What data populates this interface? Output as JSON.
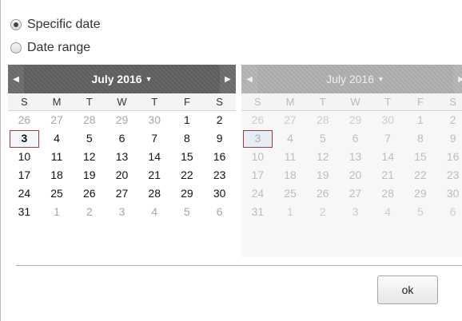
{
  "radio_options": [
    {
      "label": "Specific date",
      "checked": true
    },
    {
      "label": "Date range",
      "checked": false
    }
  ],
  "calendars": [
    {
      "month_label": "July 2016",
      "active": true,
      "prev_icon": "triangle-left-icon",
      "next_icon": "triangle-right-icon",
      "weekdays": [
        "S",
        "M",
        "T",
        "W",
        "T",
        "F",
        "S"
      ],
      "weeks": [
        [
          "26",
          "27",
          "28",
          "29",
          "30",
          "1",
          "2"
        ],
        [
          "3",
          "4",
          "5",
          "6",
          "7",
          "8",
          "9"
        ],
        [
          "10",
          "11",
          "12",
          "13",
          "14",
          "15",
          "16"
        ],
        [
          "17",
          "18",
          "19",
          "20",
          "21",
          "22",
          "23"
        ],
        [
          "24",
          "25",
          "26",
          "27",
          "28",
          "29",
          "30"
        ],
        [
          "31",
          "1",
          "2",
          "3",
          "4",
          "5",
          "6"
        ]
      ],
      "selected_day": "3"
    },
    {
      "month_label": "July 2016",
      "active": false,
      "prev_icon": "triangle-left-icon",
      "next_icon": "triangle-right-icon",
      "weekdays": [
        "S",
        "M",
        "T",
        "W",
        "T",
        "F",
        "S"
      ],
      "weeks": [
        [
          "26",
          "27",
          "28",
          "29",
          "30",
          "1",
          "2"
        ],
        [
          "3",
          "4",
          "5",
          "6",
          "7",
          "8",
          "9"
        ],
        [
          "10",
          "11",
          "12",
          "13",
          "14",
          "15",
          "16"
        ],
        [
          "17",
          "18",
          "19",
          "20",
          "21",
          "22",
          "23"
        ],
        [
          "24",
          "25",
          "26",
          "27",
          "28",
          "29",
          "30"
        ],
        [
          "31",
          "1",
          "2",
          "3",
          "4",
          "5",
          "6"
        ]
      ],
      "selected_day": "3"
    }
  ],
  "ok_button": {
    "label": "ok"
  },
  "colors": {
    "selected_border": "#a33a3a",
    "header_dark": "#5d5d5d",
    "header_disabled": "#a9a9a9"
  }
}
